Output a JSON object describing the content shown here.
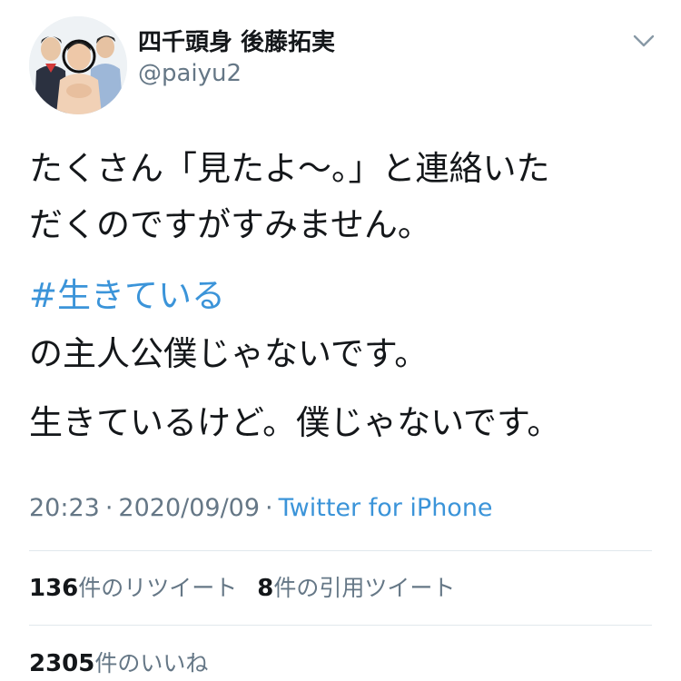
{
  "author": {
    "name": "四千頭身 後藤拓実",
    "handle": "@paiyu2"
  },
  "tweet": {
    "line1": "たくさん「見たよ〜。」と連絡いた",
    "line2": "だくのですがすみません。",
    "hashtag": "#生きている",
    "line3": "の主人公僕じゃないです。",
    "line4": "生きているけど。僕じゃないです。"
  },
  "meta": {
    "time": "20:23",
    "separator": "·",
    "date": "2020/09/09",
    "source": "Twitter for iPhone"
  },
  "stats": {
    "retweets_count": "136",
    "retweets_label": "件のリツイート",
    "quotes_count": "8",
    "quotes_label": "件の引用ツイート",
    "likes_count": "2305",
    "likes_label": "件のいいね"
  },
  "colors": {
    "link": "#3b94d9",
    "secondary_text": "#657786",
    "primary_text": "#14171a",
    "divider": "#e1e8ed"
  },
  "icons": {
    "more": "chevron-down-icon",
    "avatar": "profile-photo"
  }
}
